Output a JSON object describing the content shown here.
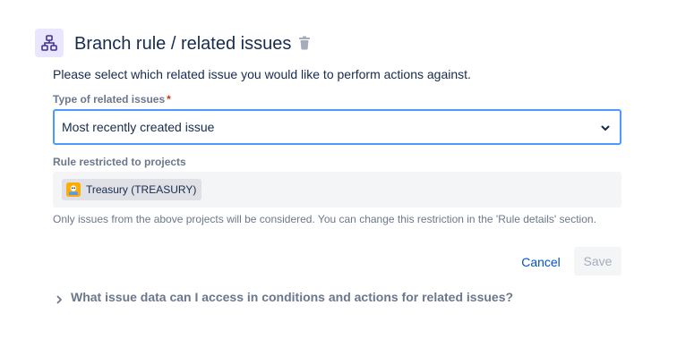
{
  "header": {
    "icon": "branch-icon",
    "title": "Branch rule / related issues",
    "delete_icon": "trash-icon"
  },
  "description": "Please select which related issue you would like to perform actions against.",
  "related_type_field": {
    "label": "Type of related issues",
    "required_marker": "*",
    "selected_value": "Most recently created issue",
    "dropdown_icon": "chevron-down-icon"
  },
  "projects_field": {
    "label": "Rule restricted to projects",
    "projects": [
      {
        "name": "Treasury (TREASURY)",
        "avatar_icon": "project-avatar-icon"
      }
    ],
    "helper_text": "Only issues from the above projects will be considered. You can change this restriction in the 'Rule details' section."
  },
  "actions": {
    "cancel_label": "Cancel",
    "save_label": "Save",
    "save_enabled": false
  },
  "expander": {
    "icon": "chevron-right-icon",
    "label": "What issue data can I access in conditions and actions for related issues?"
  },
  "colors": {
    "accent": "#0052cc",
    "focus_border": "#4c9aff",
    "header_icon_bg": "#eae6ff",
    "header_icon_fg": "#403294",
    "required": "#de350b",
    "muted_text": "#6b778c",
    "project_avatar": "#ffab00"
  }
}
